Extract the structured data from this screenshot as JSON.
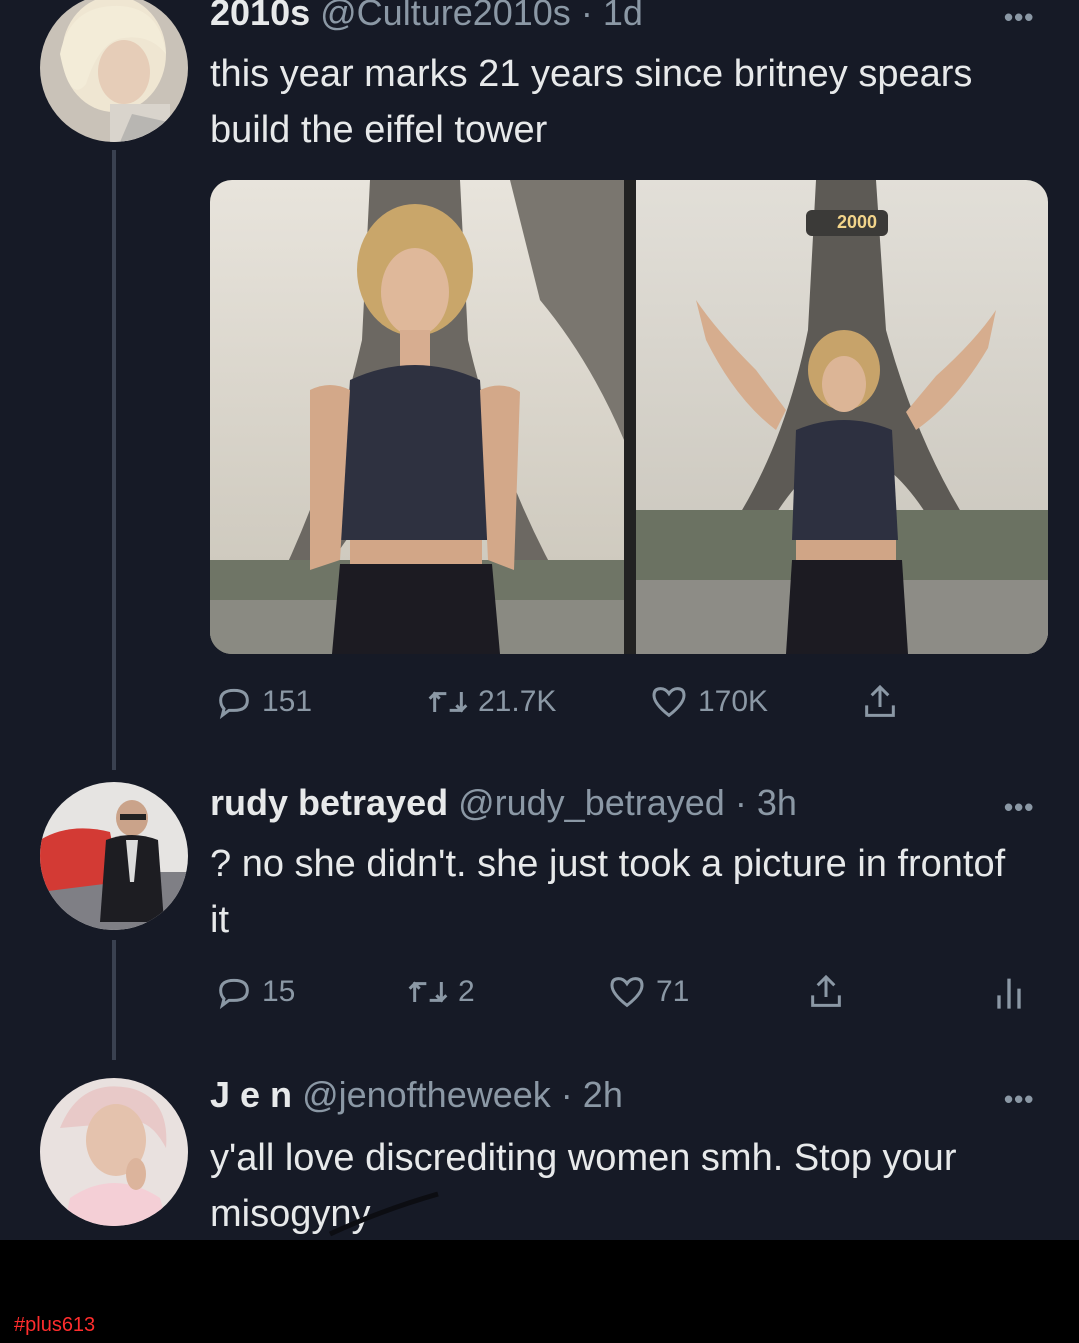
{
  "tweets": [
    {
      "name": "2010s",
      "handle": "@Culture2010s",
      "time": "1d",
      "text": "this year marks 21 years since britney spears build the eiffel tower",
      "replies": "151",
      "retweets": "21.7K",
      "likes": "170K",
      "more": "•••"
    },
    {
      "name": "rudy betrayed",
      "handle": "@rudy_betrayed",
      "time": "3h",
      "text": "? no she didn't.  she just took a picture in frontof it",
      "replies": "15",
      "retweets": "2",
      "likes": "71",
      "more": "•••"
    },
    {
      "name": "J e n",
      "handle": "@jenoftheweek",
      "time": "2h",
      "text": "y'all love discrediting women smh. Stop your misogyny",
      "more": "•••"
    }
  ],
  "media": {
    "tower_banner": "2000"
  },
  "separator": "·",
  "footer": {
    "hashtag": "#plus613"
  },
  "colors": {
    "background": "#161a26",
    "text": "#e7e9ea",
    "muted": "#8b98a5",
    "hashtag": "#ff2d2d"
  },
  "icons": [
    "reply-icon",
    "retweet-icon",
    "like-icon",
    "share-icon",
    "analytics-icon",
    "more-icon"
  ]
}
